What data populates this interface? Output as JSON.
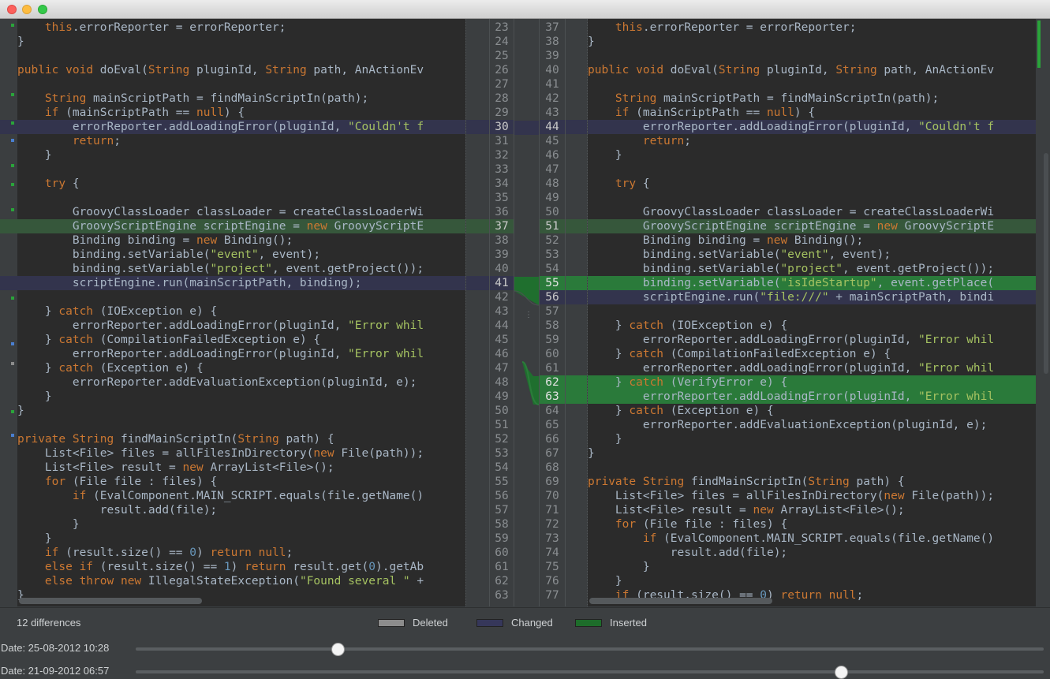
{
  "footer": {
    "differences": "12 differences",
    "legend": [
      {
        "label": "Deleted",
        "color": "#8c8c8c"
      },
      {
        "label": "Changed",
        "color": "#36375a"
      },
      {
        "label": "Inserted",
        "color": "#1d6d2a"
      }
    ],
    "date1": "Date: 25-08-2012 10:28",
    "date2": "Date: 21-09-2012 06:57",
    "slider1_position_fraction": 0.222,
    "slider2_position_fraction": 0.777
  },
  "left": {
    "line_numbers": [
      "23",
      "24",
      "25",
      "26",
      "27",
      "28",
      "29",
      "30",
      "31",
      "32",
      "33",
      "34",
      "35",
      "36",
      "37",
      "38",
      "39",
      "40",
      "41",
      "42",
      "43",
      "44",
      "45",
      "46",
      "47",
      "48",
      "49",
      "50",
      "51",
      "52",
      "53",
      "54",
      "55",
      "56",
      "57",
      "58",
      "59",
      "60",
      "61",
      "62",
      "63"
    ],
    "lines": [
      "    this.errorReporter = errorReporter;",
      "}",
      "",
      "public void doEval(String pluginId, String path, AnActionEv",
      "",
      "    String mainScriptPath = findMainScriptIn(path);",
      "    if (mainScriptPath == null) {",
      "        errorReporter.addLoadingError(pluginId, \"Couldn't f",
      "        return;",
      "    }",
      "",
      "    try {",
      "",
      "        GroovyClassLoader classLoader = createClassLoaderWi",
      "        GroovyScriptEngine scriptEngine = new GroovyScriptE",
      "        Binding binding = new Binding();",
      "        binding.setVariable(\"event\", event);",
      "        binding.setVariable(\"project\", event.getProject());",
      "        scriptEngine.run(mainScriptPath, binding);",
      "",
      "    } catch (IOException e) {",
      "        errorReporter.addLoadingError(pluginId, \"Error whil",
      "    } catch (CompilationFailedException e) {",
      "        errorReporter.addLoadingError(pluginId, \"Error whil",
      "    } catch (Exception e) {",
      "        errorReporter.addEvaluationException(pluginId, e);",
      "    }",
      "}",
      "",
      "private String findMainScriptIn(String path) {",
      "    List<File> files = allFilesInDirectory(new File(path));",
      "    List<File> result = new ArrayList<File>();",
      "    for (File file : files) {",
      "        if (EvalComponent.MAIN_SCRIPT.equals(file.getName()",
      "            result.add(file);",
      "        }",
      "    }",
      "    if (result.size() == 0) return null;",
      "    else if (result.size() == 1) return result.get(0).getAb",
      "    else throw new IllegalStateException(\"Found several \" +",
      "}"
    ]
  },
  "right": {
    "line_numbers": [
      "37",
      "38",
      "39",
      "40",
      "41",
      "42",
      "43",
      "44",
      "45",
      "46",
      "47",
      "48",
      "49",
      "50",
      "51",
      "52",
      "53",
      "54",
      "55",
      "56",
      "57",
      "58",
      "59",
      "60",
      "61",
      "62",
      "63",
      "64",
      "65",
      "66",
      "67",
      "68",
      "69",
      "70",
      "71",
      "72",
      "73",
      "74",
      "75",
      "76",
      "77"
    ],
    "lines": [
      "    this.errorReporter = errorReporter;",
      "}",
      "",
      "public void doEval(String pluginId, String path, AnActionEv",
      "",
      "    String mainScriptPath = findMainScriptIn(path);",
      "    if (mainScriptPath == null) {",
      "        errorReporter.addLoadingError(pluginId, \"Couldn't f",
      "        return;",
      "    }",
      "",
      "    try {",
      "",
      "        GroovyClassLoader classLoader = createClassLoaderWi",
      "        GroovyScriptEngine scriptEngine = new GroovyScriptE",
      "        Binding binding = new Binding();",
      "        binding.setVariable(\"event\", event);",
      "        binding.setVariable(\"project\", event.getProject());",
      "        binding.setVariable(\"isIdeStartup\", event.getPlace(",
      "        scriptEngine.run(\"file:///\" + mainScriptPath, bindi",
      "",
      "    } catch (IOException e) {",
      "        errorReporter.addLoadingError(pluginId, \"Error whil",
      "    } catch (CompilationFailedException e) {",
      "        errorReporter.addLoadingError(pluginId, \"Error whil",
      "    } catch (VerifyError e) {",
      "        errorReporter.addLoadingError(pluginId, \"Error whil",
      "    } catch (Exception e) {",
      "        errorReporter.addEvaluationException(pluginId, e);",
      "    }",
      "}",
      "",
      "private String findMainScriptIn(String path) {",
      "    List<File> files = allFilesInDirectory(new File(path));",
      "    List<File> result = new ArrayList<File>();",
      "    for (File file : files) {",
      "        if (EvalComponent.MAIN_SCRIPT.equals(file.getName()",
      "            result.add(file);",
      "        }",
      "    }",
      "    if (result.size() == 0) return null;"
    ]
  }
}
